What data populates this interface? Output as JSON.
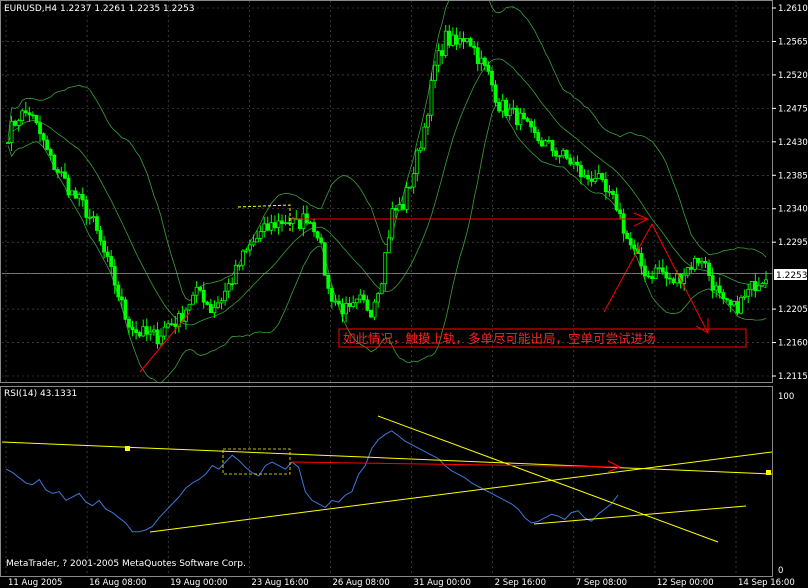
{
  "header": {
    "price_title": "EURUSD,H4  1.2237 1.2261 1.2235 1.2253",
    "rsi_title": "RSI(14) 43.1331",
    "copyright": "MetaTrader, ? 2001-2005 MetaQuotes Software Corp."
  },
  "annotation": "如此情况，触摸上轨，多单尽可能出局，空单可尝试进场",
  "colors": {
    "background": "#000000",
    "grid": "#5a5a5a",
    "candle": "#00ff00",
    "band": "#3aa03a",
    "rsi_line": "#3c78dc",
    "trendline": "#ffff00",
    "arrow": "#ff0000",
    "annotation_border": "#ff0000",
    "current_price_box": "#ffffff"
  },
  "chart_data": [
    {
      "type": "candlestick",
      "symbol": "EURUSD",
      "timeframe": "H4",
      "ohlc_last": {
        "open": 1.2237,
        "high": 1.2261,
        "low": 1.2235,
        "close": 1.2253
      },
      "current_price": 1.2253,
      "ylim": [
        1.2115,
        1.261
      ],
      "y_ticks": [
        "1.2610",
        "1.2565",
        "1.2520",
        "1.2475",
        "1.2430",
        "1.2385",
        "1.2340",
        "1.2295",
        "1.2253",
        "1.2205",
        "1.2160",
        "1.2115"
      ],
      "x_ticks": [
        "11 Aug 2005",
        "16 Aug 08:00",
        "19 Aug 00:00",
        "23 Aug 16:00",
        "26 Aug 08:00",
        "31 Aug 00:00",
        "2 Sep 16:00",
        "7 Sep 08:00",
        "12 Sep 00:00",
        "14 Sep 16:00"
      ],
      "close_path": [
        [
          0,
          1.244
        ],
        [
          3,
          1.2465
        ],
        [
          6,
          1.247
        ],
        [
          9,
          1.244
        ],
        [
          12,
          1.2405
        ],
        [
          15,
          1.2385
        ],
        [
          18,
          1.236
        ],
        [
          21,
          1.2345
        ],
        [
          24,
          1.232
        ],
        [
          27,
          1.228
        ],
        [
          30,
          1.224
        ],
        [
          33,
          1.2195
        ],
        [
          36,
          1.2175
        ],
        [
          39,
          1.217
        ],
        [
          42,
          1.2168
        ],
        [
          45,
          1.2185
        ],
        [
          48,
          1.219
        ],
        [
          51,
          1.2215
        ],
        [
          54,
          1.223
        ],
        [
          57,
          1.2205
        ],
        [
          60,
          1.222
        ],
        [
          63,
          1.2245
        ],
        [
          66,
          1.2275
        ],
        [
          69,
          1.2295
        ],
        [
          72,
          1.231
        ],
        [
          75,
          1.232
        ],
        [
          78,
          1.2325
        ],
        [
          81,
          1.2318
        ],
        [
          84,
          1.233
        ],
        [
          87,
          1.231
        ],
        [
          90,
          1.223
        ],
        [
          93,
          1.221
        ],
        [
          96,
          1.22
        ],
        [
          99,
          1.2215
        ],
        [
          102,
          1.2205
        ],
        [
          105,
          1.225
        ],
        [
          108,
          1.2335
        ],
        [
          111,
          1.2345
        ],
        [
          114,
          1.239
        ],
        [
          117,
          1.245
        ],
        [
          120,
          1.253
        ],
        [
          123,
          1.257
        ],
        [
          126,
          1.256
        ],
        [
          129,
          1.2575
        ],
        [
          132,
          1.2545
        ],
        [
          135,
          1.252
        ],
        [
          138,
          1.248
        ],
        [
          141,
          1.247
        ],
        [
          144,
          1.246
        ],
        [
          147,
          1.244
        ],
        [
          150,
          1.243
        ],
        [
          153,
          1.242
        ],
        [
          156,
          1.241
        ],
        [
          159,
          1.24
        ],
        [
          162,
          1.238
        ],
        [
          165,
          1.2385
        ],
        [
          168,
          1.236
        ],
        [
          171,
          1.2345
        ],
        [
          174,
          1.23
        ],
        [
          177,
          1.227
        ],
        [
          180,
          1.225
        ],
        [
          183,
          1.226
        ],
        [
          186,
          1.224
        ],
        [
          189,
          1.225
        ],
        [
          192,
          1.2265
        ],
        [
          195,
          1.2275
        ],
        [
          198,
          1.224
        ],
        [
          201,
          1.221
        ],
        [
          204,
          1.2205
        ],
        [
          207,
          1.222
        ],
        [
          210,
          1.224
        ],
        [
          213,
          1.2253
        ]
      ]
    },
    {
      "type": "line",
      "indicator": "RSI(14)",
      "current_value": 43.1331,
      "ylim": [
        0,
        100
      ],
      "y_ticks": [
        "100",
        "0"
      ],
      "values": [
        58,
        56,
        53,
        50,
        49,
        52,
        46,
        44,
        45,
        40,
        42,
        44,
        39,
        37,
        40,
        35,
        33,
        30,
        27,
        22,
        22,
        23,
        25,
        30,
        34,
        38,
        42,
        47,
        50,
        52,
        55,
        60,
        58,
        62,
        66,
        63,
        59,
        56,
        54,
        60,
        62,
        60,
        58,
        62,
        59,
        45,
        40,
        38,
        36,
        40,
        39,
        43,
        45,
        55,
        60,
        70,
        75,
        78,
        80,
        77,
        74,
        72,
        70,
        68,
        66,
        64,
        60,
        57,
        55,
        53,
        50,
        48,
        46,
        44,
        42,
        40,
        38,
        35,
        30,
        27,
        28,
        30,
        32,
        31,
        29,
        33,
        34,
        30,
        28,
        32,
        35,
        38,
        43
      ]
    }
  ]
}
